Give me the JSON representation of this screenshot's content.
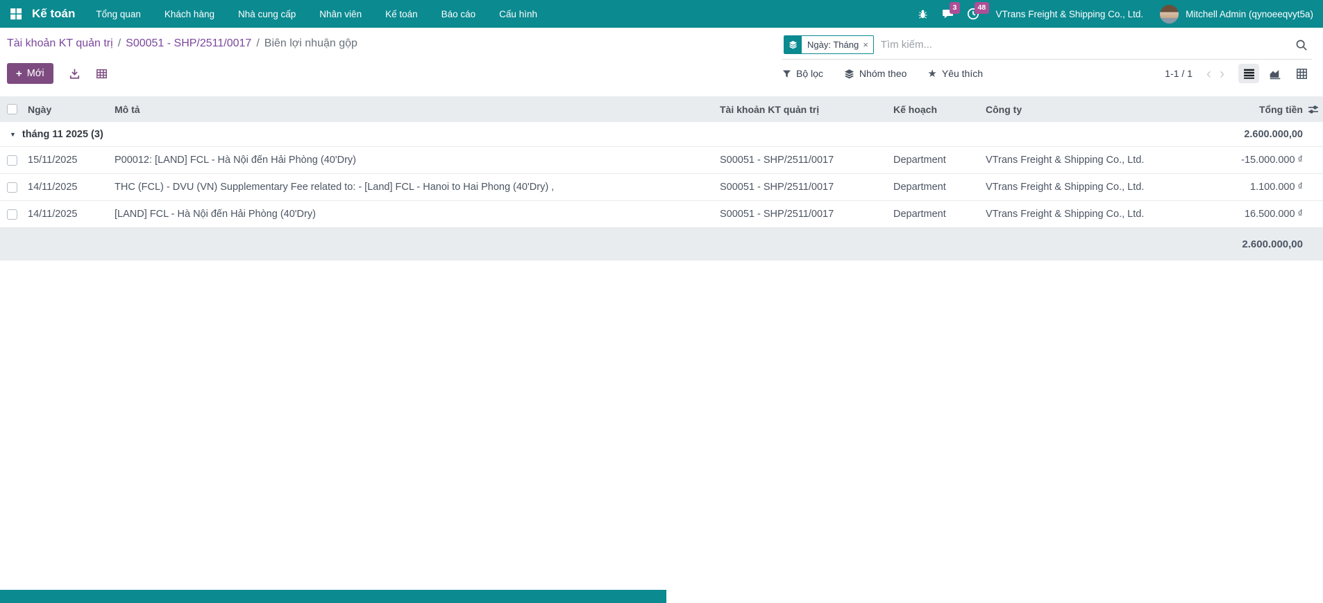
{
  "navbar": {
    "app_name": "Kế toán",
    "menu_items": [
      "Tổng quan",
      "Khách hàng",
      "Nhà cung cấp",
      "Nhân viên",
      "Kế toán",
      "Báo cáo",
      "Cấu hình"
    ],
    "message_badge": "3",
    "activity_badge": "48",
    "company": "VTrans Freight & Shipping Co., Ltd.",
    "user": "Mitchell Admin (qynoeeqvyt5a)"
  },
  "breadcrumb": {
    "level1": "Tài khoản KT quản trị",
    "level2": "S00051 - SHP/2511/0017",
    "current": "Biên lợi nhuận gộp",
    "separator": "/"
  },
  "search": {
    "facet_label": "Ngày: Tháng",
    "facet_remove": "×",
    "placeholder": "Tìm kiếm..."
  },
  "toolbar": {
    "new_label": "Mới",
    "plus_glyph": "+",
    "filter_label": "Bộ lọc",
    "groupby_label": "Nhóm theo",
    "favorite_label": "Yêu thích",
    "star_glyph": "★",
    "pager_text": "1-1 / 1",
    "prev_glyph": "‹",
    "next_glyph": "›"
  },
  "table": {
    "columns": {
      "date": "Ngày",
      "description": "Mô tả",
      "account": "Tài khoản KT quản trị",
      "plan": "Kế hoạch",
      "company": "Công ty",
      "amount": "Tổng tiền"
    },
    "group": {
      "caret": "▼",
      "label": "tháng 11 2025 (3)",
      "total": "2.600.000,00"
    },
    "rows": [
      {
        "date": "15/11/2025",
        "description": "P00012: [LAND] FCL - Hà Nội đến Hải Phòng (40'Dry)",
        "account": "S00051 - SHP/2511/0017",
        "plan": "Department",
        "company": "VTrans Freight & Shipping Co., Ltd.",
        "amount": "-15.000.000 ₫"
      },
      {
        "date": "14/11/2025",
        "description": "THC (FCL) - DVU (VN) Supplementary Fee related to: - [Land] FCL - Hanoi to Hai Phong (40'Dry) ,",
        "account": "S00051 - SHP/2511/0017",
        "plan": "Department",
        "company": "VTrans Freight & Shipping Co., Ltd.",
        "amount": "1.100.000 ₫"
      },
      {
        "date": "14/11/2025",
        "description": "[LAND] FCL - Hà Nội đến Hải Phòng (40'Dry)",
        "account": "S00051 - SHP/2511/0017",
        "plan": "Department",
        "company": "VTrans Freight & Shipping Co., Ltd.",
        "amount": "16.500.000 ₫"
      }
    ],
    "footer_total": "2.600.000,00"
  },
  "colors": {
    "navbar_bg": "#0b8a90",
    "primary_purple": "#7d4b80",
    "link_purple": "#7b479d",
    "badge_bg": "#ad4f96",
    "table_header_bg": "#e9ecef"
  }
}
